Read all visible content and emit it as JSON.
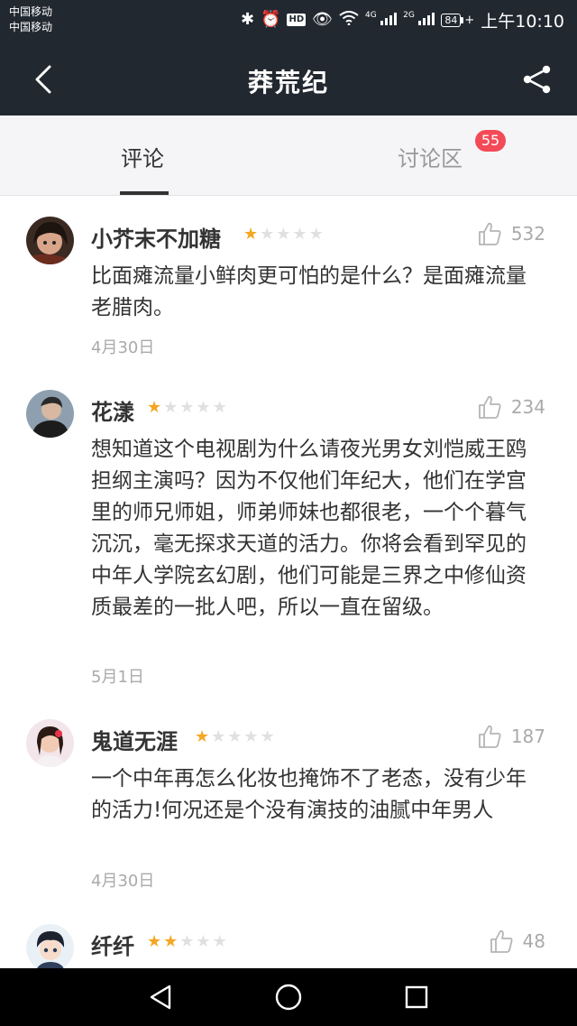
{
  "status_bar": {
    "carrier_1": "中国移动",
    "carrier_2": "中国移动",
    "hd": "HD",
    "net_1": "4G",
    "net_2": "2G",
    "battery": "84",
    "time": "上午10:10"
  },
  "header": {
    "title": "莽荒纪",
    "back_icon": "back-arrow-icon",
    "share_icon": "share-icon"
  },
  "tabs": [
    {
      "label": "评论"
    },
    {
      "label": "讨论区",
      "badge": "55"
    }
  ],
  "comments": [
    {
      "name": "小芥末不加糖",
      "rating": 1,
      "likes": "532",
      "content": "比面瘫流量小鲜肉更可怕的是什么？是面瘫流量老腊肉。",
      "date": "4月30日"
    },
    {
      "name": "花漾",
      "rating": 1,
      "likes": "234",
      "content": "想知道这个电视剧为什么请夜光男女刘恺威王鸥担纲主演吗？因为不仅他们年纪大，他们在学宫里的师兄师姐，师弟师妹也都很老，一个个暮气沉沉，毫无探求天道的活力。你将会看到罕见的中年人学院玄幻剧，他们可能是三界之中修仙资质最差的一批人吧，所以一直在留级。",
      "date": "5月1日"
    },
    {
      "name": "鬼道无涯",
      "rating": 1,
      "likes": "187",
      "content": "一个中年再怎么化妆也掩饰不了老态，没有少年的活力!何况还是个没有演技的油腻中年男人",
      "date": "4月30日"
    },
    {
      "name": "纤纤",
      "rating": 2,
      "likes": "48",
      "content": "",
      "date": ""
    }
  ],
  "nav": {
    "back_icon": "triangle-back-icon",
    "home_icon": "circle-home-icon",
    "recents_icon": "square-recents-icon"
  }
}
